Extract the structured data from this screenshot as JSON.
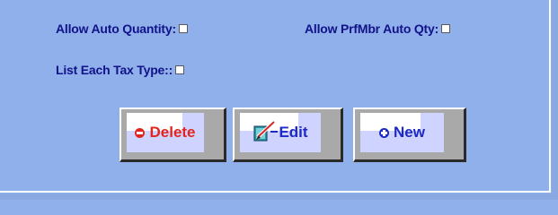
{
  "form": {
    "allow_auto_quantity_label": "Allow Auto Quantity:",
    "allow_prfmbr_auto_qty_label": "Allow PrfMbr Auto Qty:",
    "list_each_tax_type_label": "List Each Tax Type::"
  },
  "buttons": {
    "delete_label": "Delete",
    "edit_label": "Edit",
    "new_label": "New"
  },
  "colors": {
    "background": "#8fb0ea",
    "label_text": "#12128a",
    "delete_text": "#e0261e",
    "action_text": "#1c28c8"
  },
  "icons": {
    "delete": "minus-circle-icon",
    "edit": "edit-pencil-icon",
    "new": "plus-circle-icon"
  }
}
